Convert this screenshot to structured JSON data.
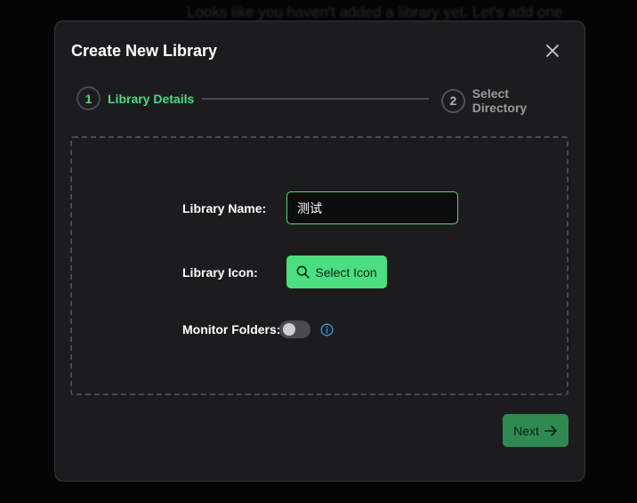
{
  "background": {
    "hint_text": "Looks like you haven't added a library yet. Let's add one"
  },
  "modal": {
    "title": "Create New Library",
    "close_icon": "close-icon"
  },
  "stepper": {
    "steps": [
      {
        "number": "1",
        "label": "Library Details",
        "active": true
      },
      {
        "number": "2",
        "label": "Select Directory",
        "active": false
      }
    ]
  },
  "form": {
    "name_label": "Library Name:",
    "name_value": "测试",
    "icon_label": "Library Icon:",
    "select_icon_label": "Select Icon",
    "monitor_label": "Monitor Folders:",
    "monitor_enabled": false
  },
  "footer": {
    "next_label": "Next"
  },
  "colors": {
    "accent": "#4ade80",
    "accent_dark": "#2f8a51",
    "modal_bg": "#1c1c1e",
    "info": "#3b9ae1"
  }
}
